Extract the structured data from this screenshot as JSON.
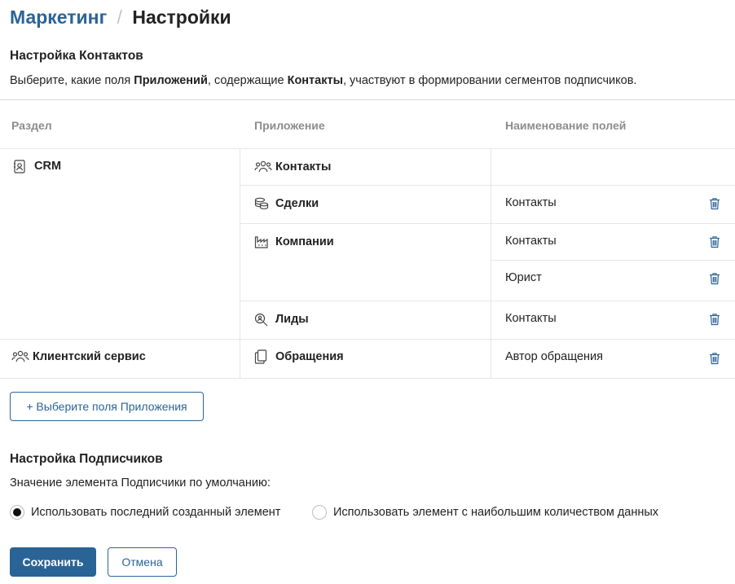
{
  "breadcrumb": {
    "parent": "Маркетинг",
    "separator": "/",
    "current": "Настройки"
  },
  "contacts_section": {
    "title": "Настройка Контактов",
    "desc_pre": "Выберите, какие поля ",
    "desc_b1": "Приложений",
    "desc_mid": ", содержащие ",
    "desc_b2": "Контакты",
    "desc_post": ", участвуют в формировании сегментов подписчиков."
  },
  "table": {
    "headers": [
      "Раздел",
      "Приложение",
      "Наименование полей"
    ],
    "sections": [
      "CRM",
      "Клиентский сервис"
    ],
    "apps": [
      "Контакты",
      "Сделки",
      "Компании",
      "Лиды",
      "Обращения"
    ],
    "fields": [
      "Контакты",
      "Контакты",
      "Юрист",
      "Контакты",
      "Автор обращения"
    ]
  },
  "add_button": "+ Выберите поля Приложения",
  "subscribers_section": {
    "title": "Настройка Подписчиков",
    "default_label": "Значение элемента Подписчики по умолчанию:",
    "options": [
      "Использовать последний созданный элемент",
      "Использовать элемент с наибольшим количеством данных"
    ],
    "selected_option": 0
  },
  "actions": {
    "save": "Сохранить",
    "cancel": "Отмена"
  },
  "colors": {
    "accent": "#2a6496",
    "border": "#e6e6e6",
    "header_text": "#8c8c8c"
  },
  "icons": {
    "crm": "contact-card-icon",
    "client_service": "users-group-icon",
    "contacts": "users-group-icon",
    "deals": "coins-icon",
    "companies": "factory-icon",
    "leads": "search-user-icon",
    "requests": "documents-icon",
    "delete": "trash-icon"
  }
}
